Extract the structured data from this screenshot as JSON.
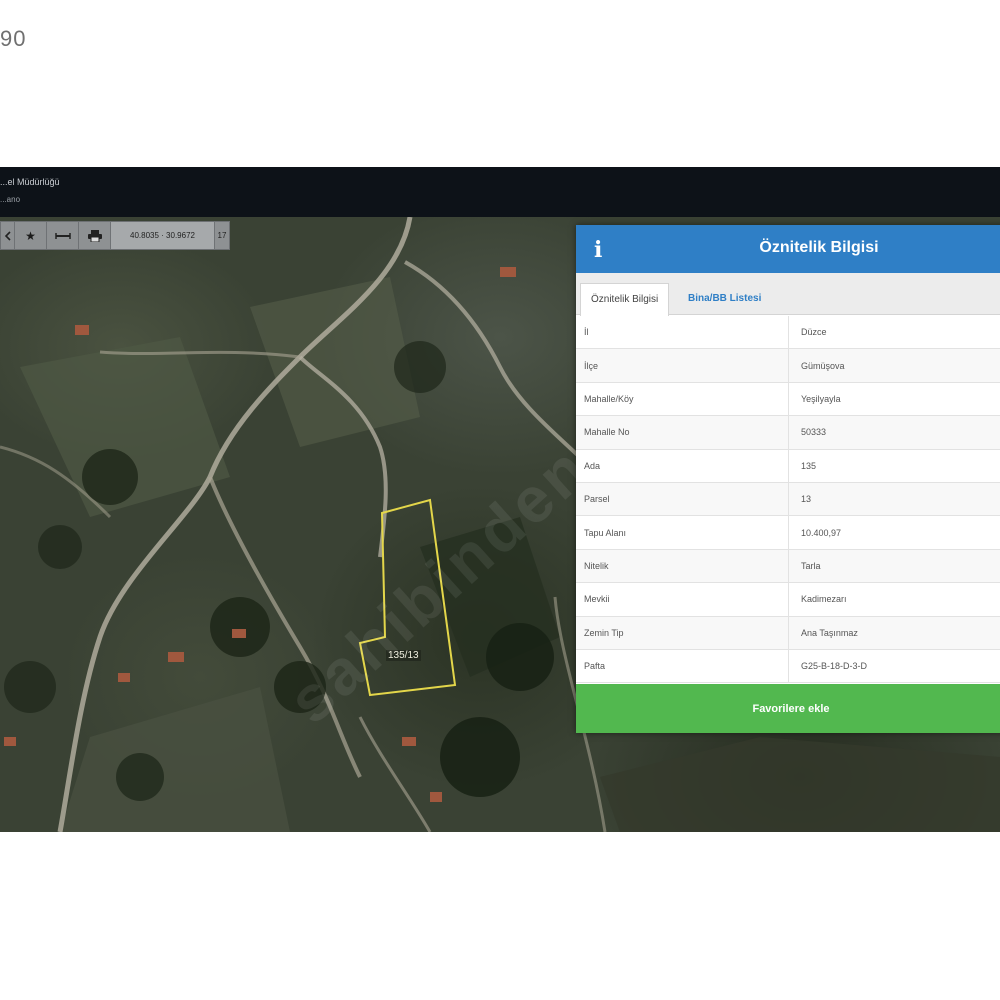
{
  "page": {
    "corner_number": "90"
  },
  "topbar": {
    "title": "...el Müdürlüğü",
    "subtitle": "...ano"
  },
  "toolbar": {
    "first_icon": "left-arrow-icon",
    "star_icon": "star-icon",
    "measure_icon": "measure-line-icon",
    "print_icon": "print-icon",
    "coordinates": "40.8035 · 30.9672",
    "zoom": "17"
  },
  "map": {
    "parcel_label": "135/13",
    "watermark": "sahibinden"
  },
  "panel": {
    "info_icon": "info-icon",
    "title": "Öznitelik Bilgisi",
    "tabs": [
      {
        "label": "Öznitelik Bilgisi",
        "active": true
      },
      {
        "label": "Bina/BB Listesi",
        "active": false
      }
    ],
    "rows": [
      {
        "key": "İl",
        "value": "Düzce"
      },
      {
        "key": "İlçe",
        "value": "Gümüşova"
      },
      {
        "key": "Mahalle/Köy",
        "value": "Yeşilyayla"
      },
      {
        "key": "Mahalle No",
        "value": "50333"
      },
      {
        "key": "Ada",
        "value": "135"
      },
      {
        "key": "Parsel",
        "value": "13"
      },
      {
        "key": "Tapu Alanı",
        "value": "10.400,97"
      },
      {
        "key": "Nitelik",
        "value": "Tarla"
      },
      {
        "key": "Mevkii",
        "value": "Kadimezarı"
      },
      {
        "key": "Zemin Tip",
        "value": "Ana Taşınmaz"
      },
      {
        "key": "Pafta",
        "value": "G25-B-18-D-3-D"
      }
    ],
    "favorite_button": "Favorilere ekle"
  },
  "colors": {
    "header_blue": "#2f7fc6",
    "favorite_green": "#52b84f",
    "parcel_outline": "#e3d64a"
  }
}
